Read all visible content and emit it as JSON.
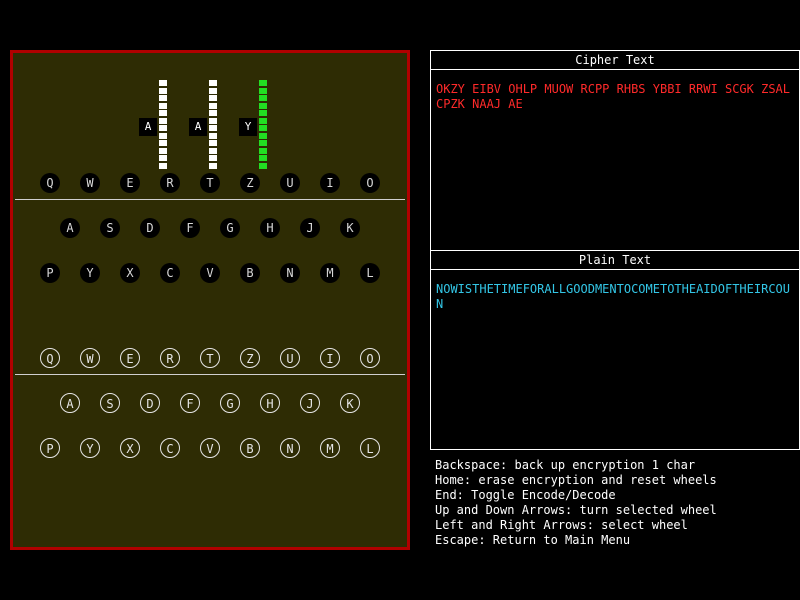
{
  "colors": {
    "frame": "#b00000",
    "machine_bg": "#2e2c04",
    "cipher_text": "#ff2a2a",
    "plain_text": "#33c6e6",
    "wheel_normal": "#ffffff",
    "wheel_selected": "#22dd22"
  },
  "wheels": [
    {
      "letter": "A",
      "selected": false
    },
    {
      "letter": "A",
      "selected": false
    },
    {
      "letter": "Y",
      "selected": true
    }
  ],
  "keyboard_rows": [
    [
      "Q",
      "W",
      "E",
      "R",
      "T",
      "Z",
      "U",
      "I",
      "O"
    ],
    [
      "A",
      "S",
      "D",
      "F",
      "G",
      "H",
      "J",
      "K"
    ],
    [
      "P",
      "Y",
      "X",
      "C",
      "V",
      "B",
      "N",
      "M",
      "L"
    ]
  ],
  "cipher_panel": {
    "title": "Cipher Text",
    "text": "OKZY EIBV OHLP MUOW RCPP RHBS YBBI RRWI SCGK ZSAL CPZK NAAJ AE"
  },
  "plain_panel": {
    "title": "Plain Text",
    "text": "NOWISTHETIMEFORALLGOODMENTOCOMETOTHEAIDOFTHEIRCOUN"
  },
  "help_lines": [
    "Backspace: back up encryption 1 char",
    "Home: erase encryption and reset wheels",
    "End: Toggle Encode/Decode",
    "Up and Down Arrows: turn selected wheel",
    "Left and Right Arrows: select wheel",
    "Escape: Return to Main Menu"
  ]
}
